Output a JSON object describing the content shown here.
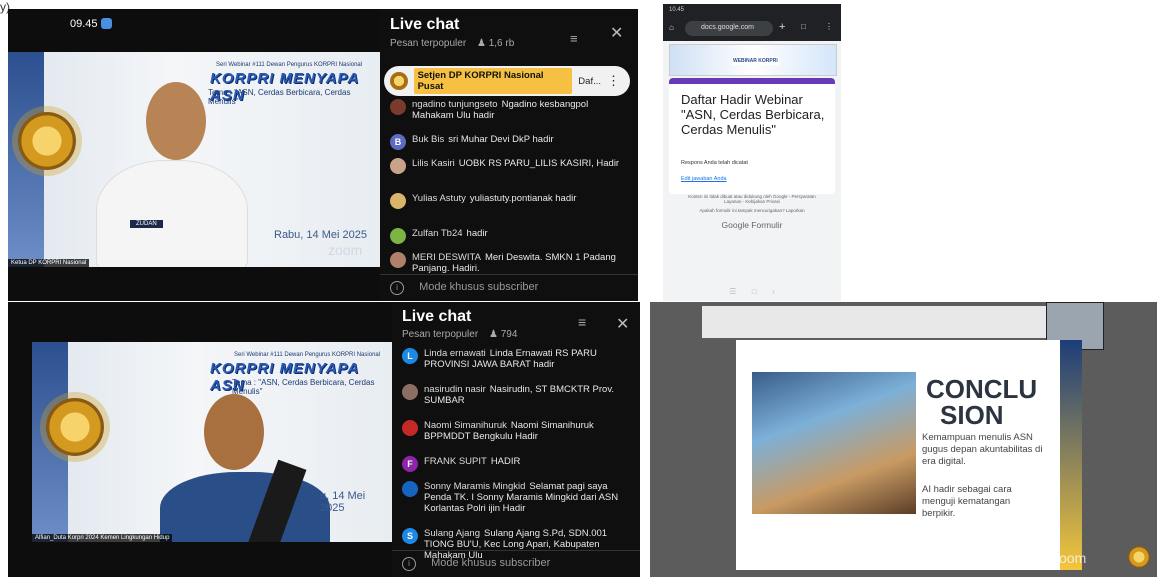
{
  "label_top": "y)",
  "top_left": {
    "status_time": "09.45",
    "series": "Seri Webinar #111 Dewan Pengurus KORPRI Nasional",
    "headline": "KORPRI MENYAPA ASN",
    "tema": "Tema : \"ASN, Cerdas Berbicara, Cerdas Menulis\"",
    "date": "Rabu, 14 Mei 2025",
    "watermark": "zoom",
    "speaker_label": "Ketua DP KORPRI Nasional",
    "badge": "ZUDAN"
  },
  "chat_top": {
    "title": "Live chat",
    "subtitle": "Pesan terpopuler",
    "viewers": "1,6 rb",
    "pinned_author": "Setjen DP KORPRI Nasional Pusat",
    "pinned_text": "Daf...",
    "messages": [
      {
        "author": "ngadino tunjungseto",
        "text": "Ngadino kesbangpol Mahakam Ulu hadir",
        "color": "#7a3b2e",
        "initial": ""
      },
      {
        "author": "Buk Bis",
        "text": "sri Muhar Devi DkP hadir",
        "color": "#5c6bc0",
        "initial": "B"
      },
      {
        "author": "Lilis Kasiri",
        "text": "UOBK RS PARU_LILIS KASIRI, Hadir",
        "color": "#c9a28a",
        "initial": ""
      },
      {
        "author": "Yulias Astuty",
        "text": "yuliastuty.pontianak hadir",
        "color": "#d9b46b",
        "initial": ""
      },
      {
        "author": "Zulfan Tb24",
        "text": "hadir",
        "color": "#7cb342",
        "initial": ""
      },
      {
        "author": "MERI DESWITA",
        "text": "Meri Deswita. SMKN 1 Padang Panjang. Hadiri.",
        "color": "#b0806a",
        "initial": ""
      }
    ],
    "footer": "Mode khusus subscriber"
  },
  "phone": {
    "status": "10.45",
    "url": "docs.google.com",
    "banner": "WEBINAR KORPRI",
    "form_title": "Daftar Hadir Webinar \"ASN, Cerdas Berbicara, Cerdas Menulis\"",
    "recorded": "Respons Anda telah dicatat",
    "edit_link": "Edit jawaban Anda",
    "disclaimer": "Konten ini tidak dibuat atau didukung oleh Google - Persyaratan Layanan - Kebijakan Privasi",
    "phish": "Apakah formulir ini tampak mencurigakan? Laporkan",
    "brand": "Google Formulir"
  },
  "bottom_left": {
    "series": "Seri Webinar #111 Dewan Pengurus KORPRI Nasional",
    "headline": "KORPRI MENYAPA ASN",
    "tema": "Tema : \"ASN, Cerdas Berbicara, Cerdas Menulis\"",
    "date": "u, 14 Mei 2025",
    "speaker_label": "Alfian_Duta Korpri 2024 Kemen Lingkungan Hidup"
  },
  "chat_bottom": {
    "title": "Live chat",
    "subtitle": "Pesan terpopuler",
    "viewers": "794",
    "messages": [
      {
        "author": "Linda ernawati",
        "text": "Linda Ernawati RS PARU PROVINSI JAWA BARAT hadir",
        "color": "#1e88e5",
        "initial": "L"
      },
      {
        "author": "nasirudin nasir",
        "text": "Nasirudin, ST BMCKTR Prov. SUMBAR",
        "color": "#8d6e63",
        "initial": ""
      },
      {
        "author": "Naomi Simanihuruk",
        "text": "Naomi Simanihuruk BPPMDDT Bengkulu Hadir",
        "color": "#c62828",
        "initial": ""
      },
      {
        "author": "FRANK SUPIT",
        "text": "HADIR",
        "color": "#8e24aa",
        "initial": "F"
      },
      {
        "author": "Sonny Maramis Mingkid",
        "text": "Selamat pagi saya Penda TK. I Sonny Maramis Mingkid dari ASN Korlantas Polri ijin Hadir",
        "color": "#1565c0",
        "initial": ""
      },
      {
        "author": "Sulang Ajang",
        "text": "Sulang Ajang S.Pd, SDN.001 TIONG BU'U, Kec Long Apari, Kabupaten Mahakam Ulu",
        "color": "#1e88e5",
        "initial": "S"
      }
    ],
    "footer": "Mode khusus subscriber"
  },
  "slide": {
    "heading1": "CONCLU",
    "heading2": "SION",
    "para1": "Kemampuan menulis ASN gugus depan akuntabilitas di era digital.",
    "para2": "AI hadir sebagai cara menguji kematangan berpikir.",
    "watermark": "zoom"
  }
}
